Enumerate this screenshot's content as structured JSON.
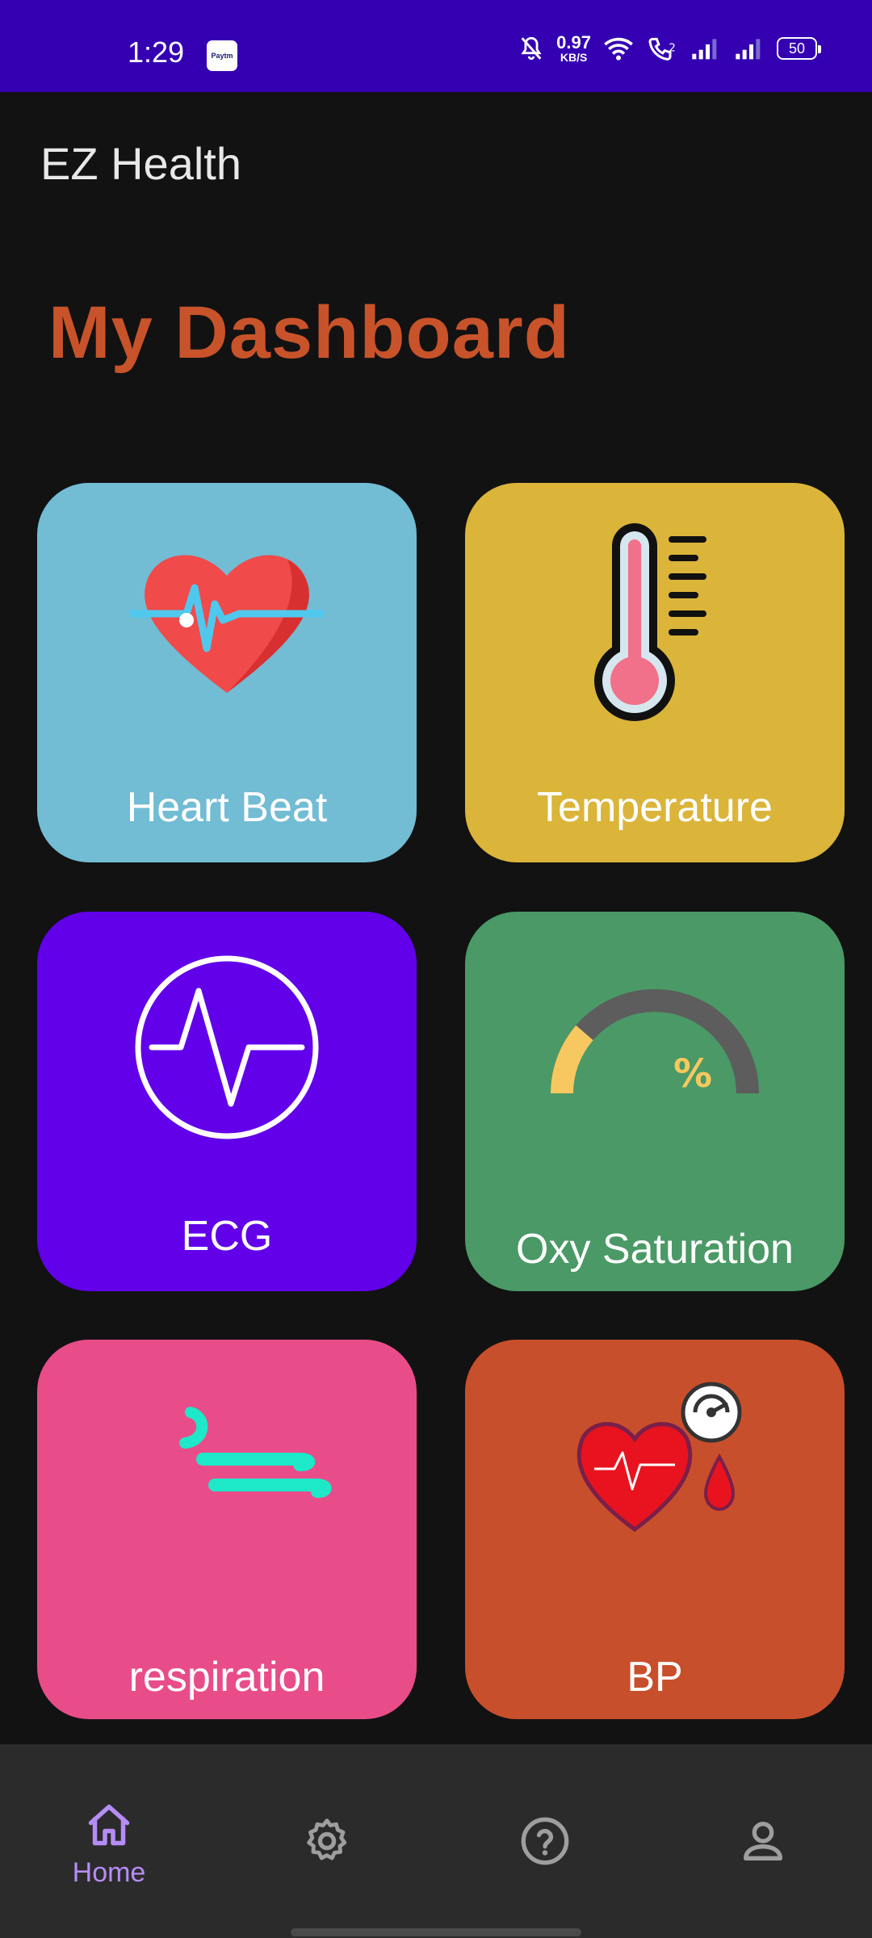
{
  "status_bar": {
    "time": "1:29",
    "paytm_label": "Paytm",
    "net_speed_value": "0.97",
    "net_speed_unit": "KB/S",
    "battery": "50",
    "background": "#3400b2"
  },
  "app": {
    "title": "EZ Health"
  },
  "dashboard": {
    "title": "My Dashboard",
    "tiles": [
      {
        "label": "Heart Beat",
        "color": "#72bcd4",
        "icon": "heart-beat-icon"
      },
      {
        "label": "Temperature",
        "color": "#dbb43a",
        "icon": "thermometer-icon"
      },
      {
        "label": "ECG",
        "color": "#6200ea",
        "icon": "ecg-icon"
      },
      {
        "label": "Oxy Saturation",
        "color": "#4a9966",
        "icon": "oxygen-gauge-icon",
        "gauge_symbol": "%"
      },
      {
        "label": "respiration",
        "color": "#e84d8a",
        "icon": "respiration-icon"
      },
      {
        "label": "BP",
        "color": "#c84f2c",
        "icon": "blood-pressure-icon"
      }
    ]
  },
  "bottom_nav": {
    "items": [
      {
        "label": "Home",
        "icon": "home-icon",
        "active": true
      },
      {
        "label": "",
        "icon": "settings-gear-icon",
        "active": false
      },
      {
        "label": "",
        "icon": "help-icon",
        "active": false
      },
      {
        "label": "",
        "icon": "profile-icon",
        "active": false
      }
    ],
    "active_color": "#b68cf6",
    "inactive_color": "#9e9e9e"
  }
}
